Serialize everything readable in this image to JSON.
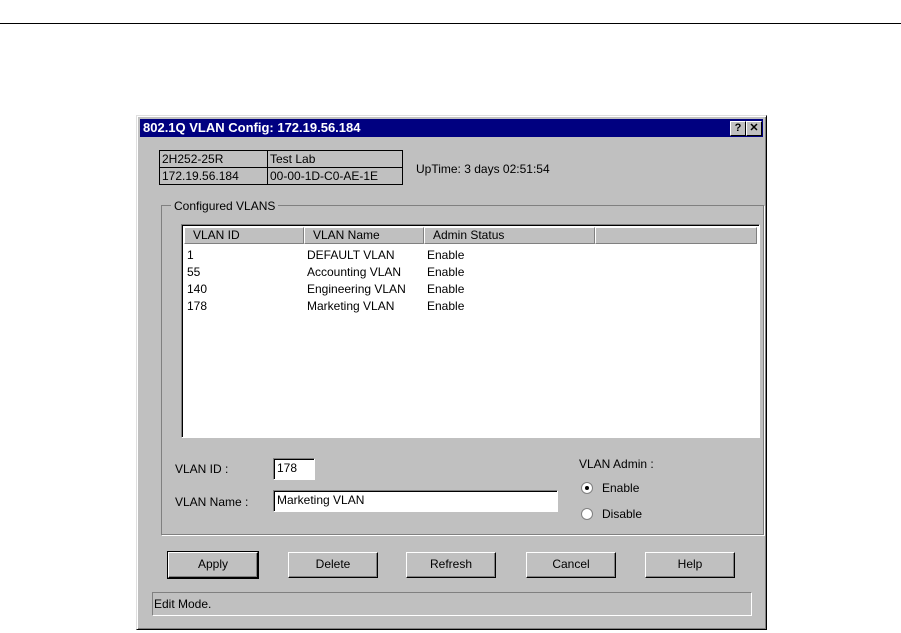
{
  "window": {
    "title": "802.1Q VLAN Config: 172.19.56.184",
    "help_button": "?",
    "close_button": "✕"
  },
  "info": {
    "device": "2H252-25R",
    "location": "Test Lab",
    "ip": "172.19.56.184",
    "mac": "00-00-1D-C0-AE-1E",
    "uptime": "UpTime: 3 days 02:51:54"
  },
  "group_label": "Configured VLANS",
  "list": {
    "columns": [
      "VLAN ID",
      "VLAN Name",
      "Admin Status",
      ""
    ],
    "rows": [
      [
        "1",
        "DEFAULT VLAN",
        "Enable"
      ],
      [
        "55",
        "Accounting VLAN",
        "Enable"
      ],
      [
        "140",
        "Engineering VLAN",
        "Enable"
      ],
      [
        "178",
        "Marketing VLAN",
        "Enable"
      ]
    ]
  },
  "form": {
    "vlan_id_label": "VLAN ID :",
    "vlan_id_value": "178",
    "vlan_name_label": "VLAN Name :",
    "vlan_name_value": "Marketing VLAN",
    "admin_label": "VLAN Admin :",
    "enable_label": "Enable",
    "disable_label": "Disable",
    "admin_selected": "Enable"
  },
  "buttons": {
    "apply": "Apply",
    "delete": "Delete",
    "refresh": "Refresh",
    "cancel": "Cancel",
    "help": "Help"
  },
  "status": "Edit Mode."
}
